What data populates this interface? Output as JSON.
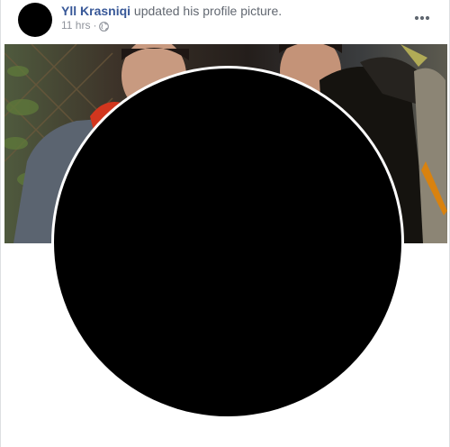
{
  "post": {
    "author_name": "Yll Krasniqi",
    "action_text": "updated his profile picture.",
    "timestamp": "11 hrs",
    "separator": "·",
    "privacy_icon": "globe-icon",
    "more_icon": "more-options-icon"
  },
  "colors": {
    "author_link": "#385898",
    "meta_text": "#90949c",
    "profile_picture": "#000000"
  }
}
